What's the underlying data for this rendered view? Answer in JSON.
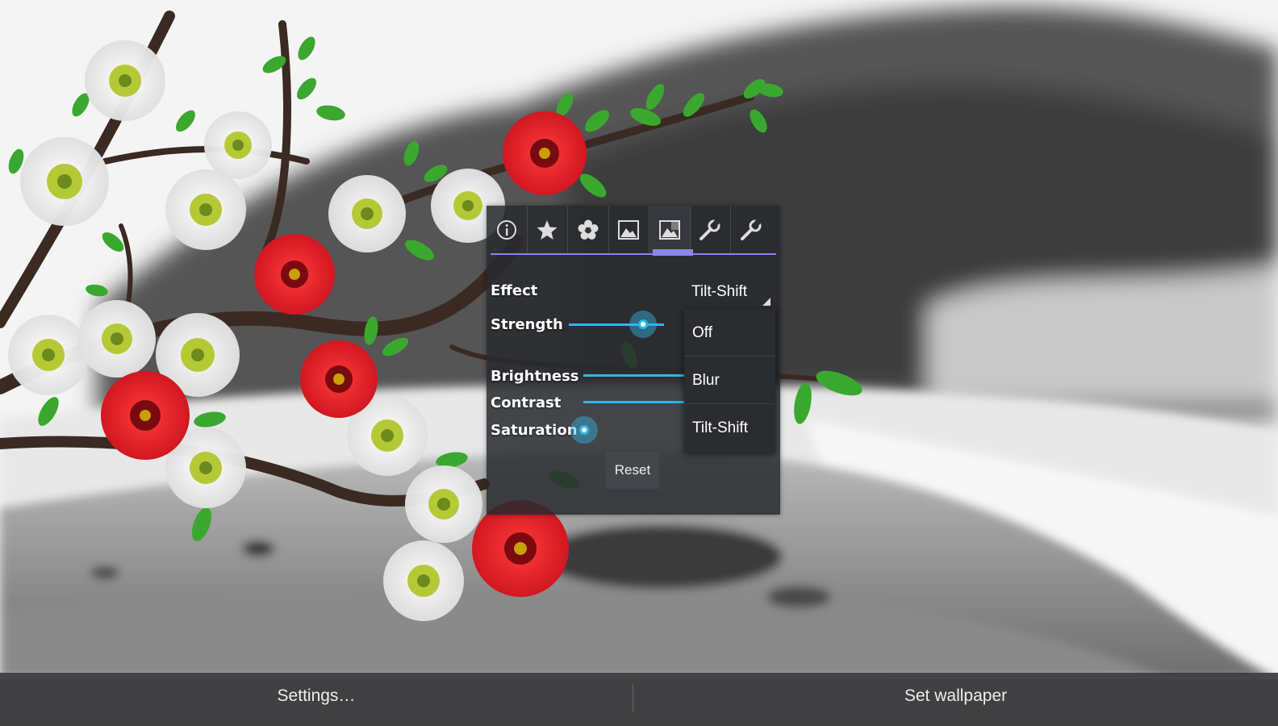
{
  "tabs": [
    {
      "icon": "info-icon"
    },
    {
      "icon": "star-icon"
    },
    {
      "icon": "flower-icon"
    },
    {
      "icon": "picture-icon"
    },
    {
      "icon": "picture-effect-icon"
    },
    {
      "icon": "wrench-icon"
    },
    {
      "icon": "wrench-alt-icon"
    }
  ],
  "settings": {
    "effect_label": "Effect",
    "effect_value": "Tilt-Shift",
    "strength_label": "Strength",
    "strength_level": 0.62,
    "brightness_label": "Brightness",
    "brightness_level": 0.5,
    "contrast_label": "Contrast",
    "contrast_level": 0.5,
    "saturation_label": "Saturation",
    "saturation_level": 0.0,
    "reset_label": "Reset"
  },
  "effect_options": [
    "Off",
    "Blur",
    "Tilt-Shift"
  ],
  "bottom_bar": {
    "settings_label": "Settings…",
    "set_wallpaper_label": "Set wallpaper"
  },
  "colors": {
    "accent_blue": "#33b5e5",
    "tab_indicator": "#8a86e8",
    "flower_red": "#e8232c",
    "flower_white": "#f2f2f2",
    "leaf_green": "#3aa82e"
  }
}
